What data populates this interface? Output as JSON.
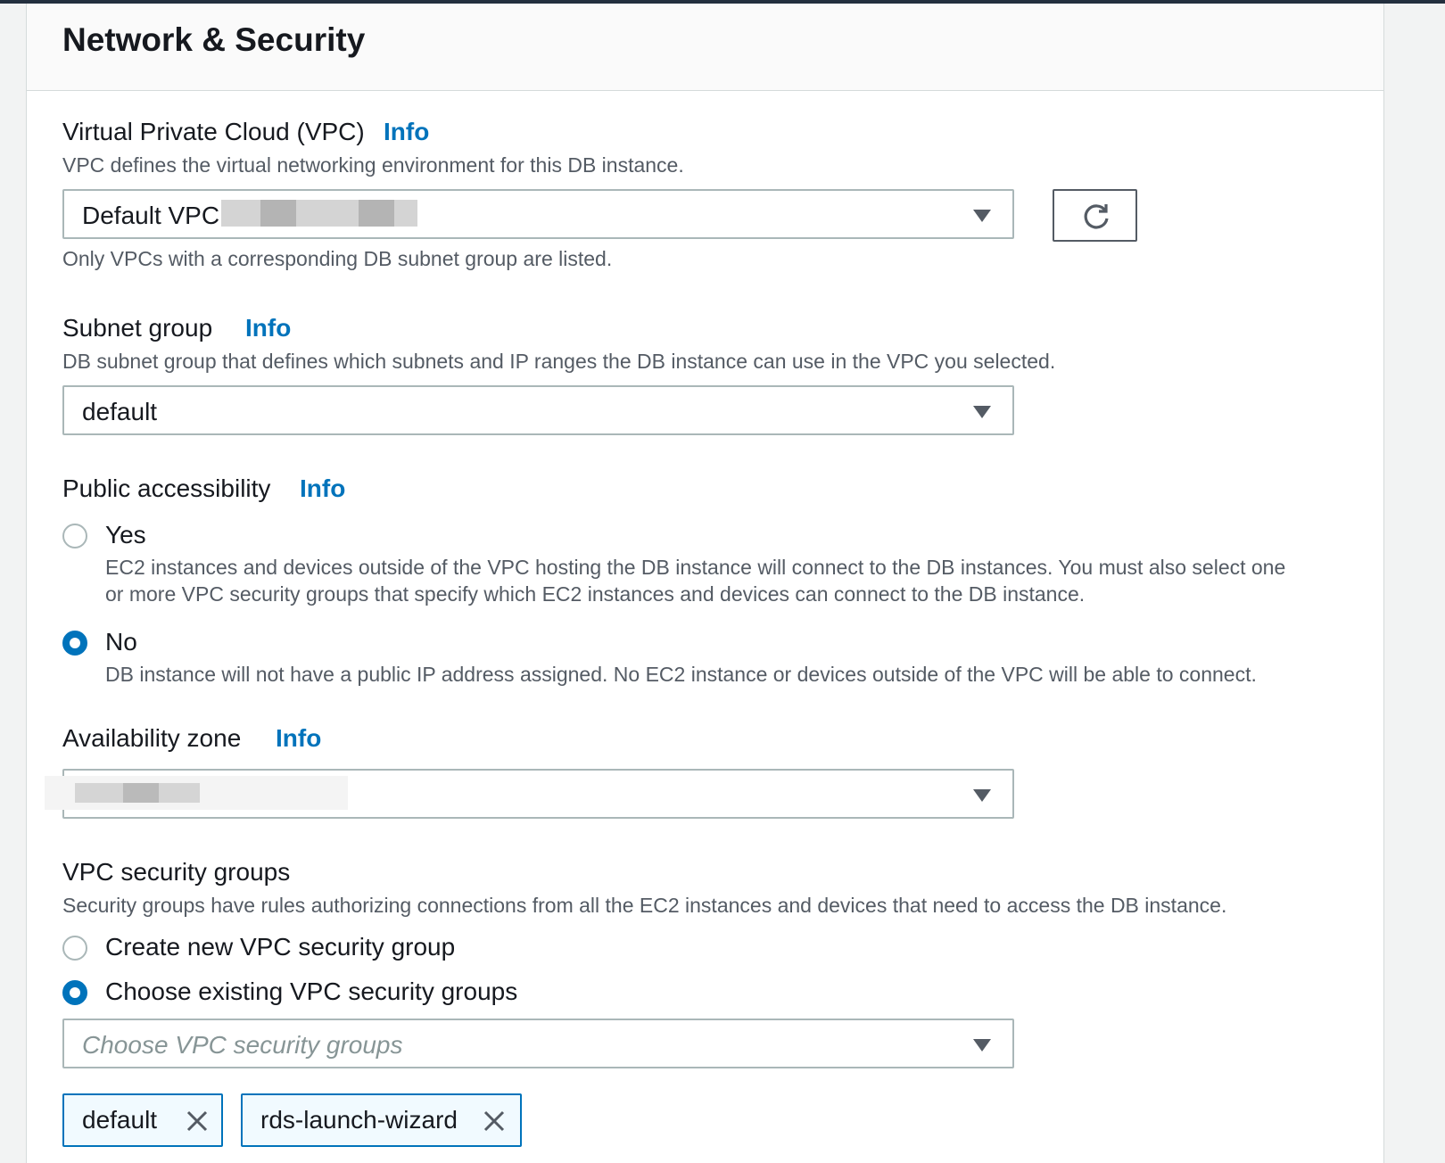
{
  "section": {
    "title": "Network & Security"
  },
  "vpc": {
    "label": "Virtual Private Cloud (VPC)",
    "info": "Info",
    "description": "VPC defines the virtual networking environment for this DB instance.",
    "selected": "Default VPC",
    "note": "Only VPCs with a corresponding DB subnet group are listed.",
    "refresh_icon": "refresh-icon"
  },
  "subnet_group": {
    "label": "Subnet group",
    "info": "Info",
    "description": "DB subnet group that defines which subnets and IP ranges the DB instance can use in the VPC you selected.",
    "selected": "default"
  },
  "public_accessibility": {
    "label": "Public accessibility",
    "info": "Info",
    "options": [
      {
        "label": "Yes",
        "description_line1": "EC2 instances and devices outside of the VPC hosting the DB instance will connect to the DB instances. You must also select one",
        "description_line2": "or more VPC security groups that specify which EC2 instances and devices can connect to the DB instance.",
        "checked": false
      },
      {
        "label": "No",
        "description_line1": "DB instance will not have a public IP address assigned. No EC2 instance or devices outside of the VPC will be able to connect.",
        "checked": true
      }
    ]
  },
  "availability_zone": {
    "label": "Availability zone",
    "info": "Info",
    "selected": ""
  },
  "security_groups": {
    "label": "VPC security groups",
    "description": "Security groups have rules authorizing connections from all the EC2 instances and devices that need to access the DB instance.",
    "options": [
      {
        "label": "Create new VPC security group",
        "checked": false
      },
      {
        "label": "Choose existing VPC security groups",
        "checked": true
      }
    ],
    "placeholder": "Choose VPC security groups",
    "tokens": [
      {
        "label": "default"
      },
      {
        "label": "rds-launch-wizard"
      }
    ]
  },
  "colors": {
    "link": "#0073bb",
    "radio_checked": "#0073bb",
    "token_bg": "#f1faff"
  }
}
